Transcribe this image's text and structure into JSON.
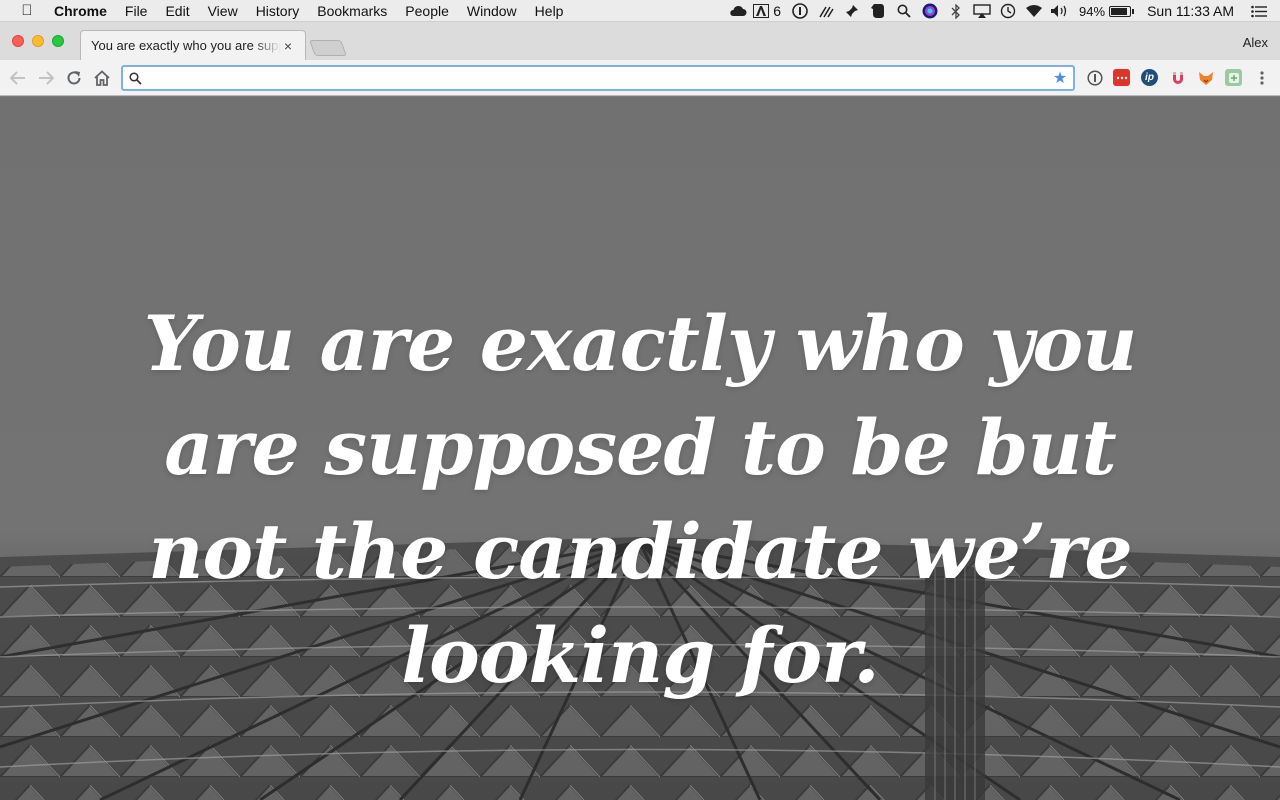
{
  "menubar": {
    "apple_icon": "apple-icon",
    "app_name": "Chrome",
    "menus": [
      "File",
      "Edit",
      "View",
      "History",
      "Bookmarks",
      "People",
      "Window",
      "Help"
    ],
    "status": {
      "adobe_count": "6",
      "battery_percent": "94%",
      "clock": "Sun 11:33 AM"
    }
  },
  "tab": {
    "title": "You are exactly who you are supposed to be but not the candidate we’re looking for.",
    "close_glyph": "×"
  },
  "profile": {
    "name": "Alex"
  },
  "omnibox": {
    "value": "",
    "placeholder": ""
  },
  "page": {
    "quote": "You are exactly who you are supposed to be but not the candidate we’re looking for."
  },
  "colors": {
    "accent": "#4a8fe3",
    "close": "#fc5f57",
    "minimize": "#fdbc2e",
    "maximize": "#28c83f"
  }
}
